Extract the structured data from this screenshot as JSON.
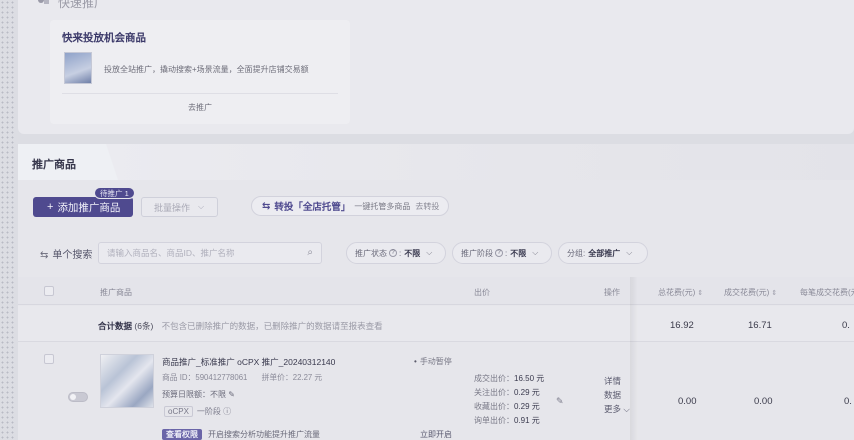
{
  "top_card": {
    "cut_title": "快速推广",
    "opportunity": {
      "title": "快来投放机会商品",
      "description": "投放全站推广，撬动搜索+场景流量，全面提升店铺交易额",
      "link": "去推广"
    }
  },
  "main": {
    "tab": "推广商品",
    "add_button": "添加推广商品",
    "pending_badge": "待推广 1",
    "batch_button": "批量操作",
    "transfer": {
      "prefix": "转投「全店托管」",
      "text": "一键托管多商品",
      "go": "去转投"
    },
    "filters": {
      "search_mode": "单个搜索",
      "search_placeholder": "请输入商品名、商品ID、推广名称",
      "status_label": "推广状态",
      "status_value": "不限",
      "stage_label": "推广阶段",
      "stage_value": "不限",
      "category_label": "分组:",
      "category_value": "全部推广"
    },
    "table": {
      "columns": {
        "product": "推广商品",
        "bid": "出价",
        "ops": "操作",
        "total_cost": "总花费(元)",
        "deal_cost": "成交花费(元)",
        "per_cost": "每笔成交花费(元)"
      },
      "summary": {
        "label": "合计数据",
        "count": "(6条)",
        "note": "不包含已删除推广的数据，已删除推广的数据请至报表查看",
        "total_cost": "16.92",
        "deal_cost": "16.71",
        "per_cost": "0."
      },
      "row": {
        "name": "商品推广_标准推广 oCPX 推广_20240312140",
        "status": "手动暂停",
        "product_id": "商品 ID：590412778061",
        "price": "拼单价：22.27 元",
        "budget": "预算日限额：不限",
        "ocpx": "oCPX",
        "ocpx_stage": "一阶段",
        "bids": [
          {
            "label": "成交出价：",
            "value": "16.50 元"
          },
          {
            "label": "关注出价：",
            "value": "0.29 元"
          },
          {
            "label": "收藏出价：",
            "value": "0.29 元"
          },
          {
            "label": "询单出价：",
            "value": "0.91 元"
          }
        ],
        "ops": [
          "详情",
          "数据",
          "更多"
        ],
        "total_cost": "0.00",
        "deal_cost": "0.00",
        "per_cost": "0.",
        "banner_tag": "查看权限",
        "banner_text": "开启搜索分析功能提升推广流量",
        "banner_go": "立即开启"
      }
    }
  }
}
